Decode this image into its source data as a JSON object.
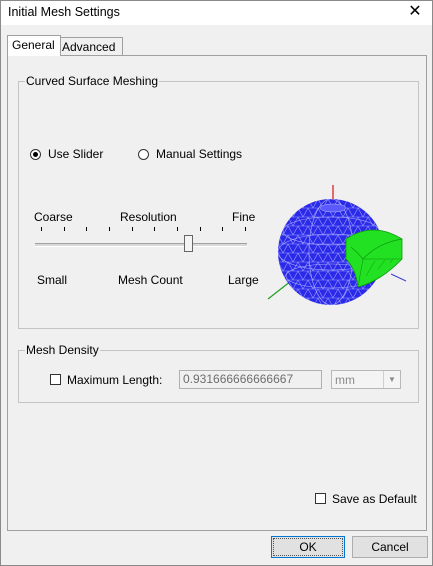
{
  "window": {
    "title": "Initial Mesh Settings",
    "close_glyph": "✕"
  },
  "tabs": [
    {
      "label": "General",
      "active": true
    },
    {
      "label": "Advanced",
      "active": false
    }
  ],
  "curved_surface": {
    "legend": "Curved Surface Meshing",
    "mode_options": [
      {
        "label": "Use Slider",
        "selected": true
      },
      {
        "label": "Manual Settings",
        "selected": false
      }
    ],
    "resolution": {
      "coarse": "Coarse",
      "title": "Resolution",
      "fine": "Fine"
    },
    "mesh_count": {
      "small": "Small",
      "title": "Mesh Count",
      "large": "Large"
    },
    "slider": {
      "ticks": 10,
      "value_fraction": 0.74
    },
    "preview_icon": "mesh-preview-icon"
  },
  "mesh_density": {
    "legend": "Mesh Density",
    "max_length_label": "Maximum Length:",
    "max_length_checked": false,
    "max_length_value": "0.931666666666667",
    "unit": "mm"
  },
  "save_default_label": "Save as Default",
  "buttons": {
    "ok": "OK",
    "cancel": "Cancel"
  },
  "colors": {
    "sphere": "#2a2ae8",
    "mesh_lines": "#9090ff",
    "gear": "#22e022",
    "axis_red": "#e01010",
    "axis_green": "#20a020"
  }
}
